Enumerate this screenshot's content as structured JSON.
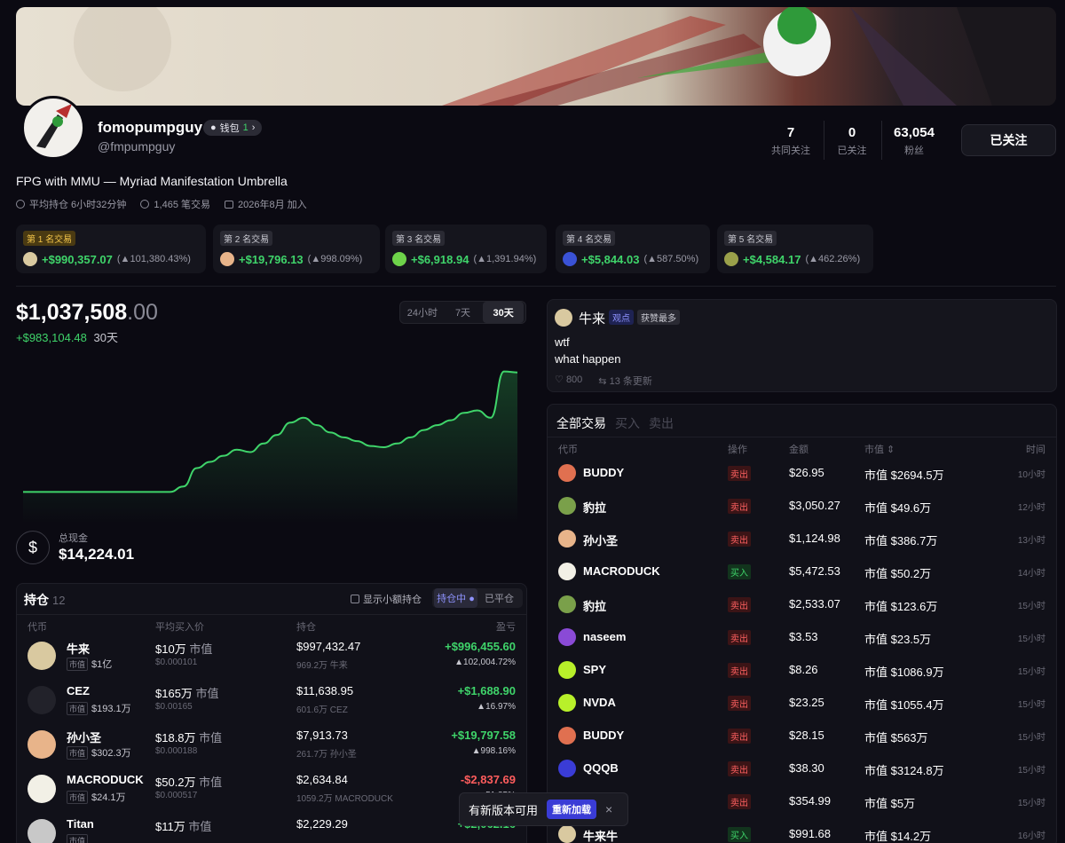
{
  "profile": {
    "name": "fomopumpguy",
    "handle": "@fmpumpguy",
    "wallet_label": "钱包",
    "wallet_count": "1",
    "bio": "FPG with MMU — Myriad Manifestation Umbrella",
    "avg_hold": "平均持仓 6小时32分钟",
    "trades": "1,465 笔交易",
    "joined": "2026年8月 加入"
  },
  "stats": [
    {
      "n": "7",
      "l": "共同关注"
    },
    {
      "n": "0",
      "l": "已关注"
    },
    {
      "n": "63,054",
      "l": "粉丝"
    }
  ],
  "follow_label": "已关注",
  "top_trades": [
    {
      "badge": "第 1 名交易",
      "amount": "+$990,357.07",
      "pct": "101,380.43%",
      "color": "#d9c9a0",
      "gold": true
    },
    {
      "badge": "第 2 名交易",
      "amount": "+$19,796.13",
      "pct": "998.09%",
      "color": "#e8b48a"
    },
    {
      "badge": "第 3 名交易",
      "amount": "+$6,918.94",
      "pct": "1,391.94%",
      "color": "#6ed34a"
    },
    {
      "badge": "第 4 名交易",
      "amount": "+$5,844.03",
      "pct": "587.50%",
      "color": "#3a52d6"
    },
    {
      "badge": "第 5 名交易",
      "amount": "+$4,584.17",
      "pct": "462.26%",
      "color": "#9aa04a"
    }
  ],
  "balance": {
    "main": "$1,037,508",
    "dec": ".00",
    "change": "+$983,104.48",
    "period": "30天"
  },
  "ranges": [
    "24小时",
    "7天",
    "30天"
  ],
  "cash": {
    "label": "总现金",
    "value": "$14,224.01",
    "icon": "$"
  },
  "holdings": {
    "title": "持仓",
    "count": "12",
    "show_small": "显示小额持仓",
    "seg_open": "持仓中",
    "seg_closed": "已平仓",
    "headers": [
      "代币",
      "平均买入价",
      "持仓",
      "盈亏"
    ],
    "rows": [
      {
        "name": "牛来",
        "tag": "市值",
        "mc": "$1亿",
        "avg": "$10万",
        "avg_unit": "市值",
        "avg_sub": "$0.000101",
        "hold": "$997,432.47",
        "hold_sub": "969.2万 牛来",
        "pnl": "+$996,455.60",
        "pnl_pct": "▲102,004.72%",
        "up": true,
        "color": "#d9c9a0"
      },
      {
        "name": "CEZ",
        "tag": "市值",
        "mc": "$193.1万",
        "avg": "$165万",
        "avg_unit": "市值",
        "avg_sub": "$0.00165",
        "hold": "$11,638.95",
        "hold_sub": "601.6万 CEZ",
        "pnl": "+$1,688.90",
        "pnl_pct": "▲16.97%",
        "up": true,
        "color": "#22222a"
      },
      {
        "name": "孙小圣",
        "tag": "市值",
        "mc": "$302.3万",
        "avg": "$18.8万",
        "avg_unit": "市值",
        "avg_sub": "$0.000188",
        "hold": "$7,913.73",
        "hold_sub": "261.7万 孙小圣",
        "pnl": "+$19,797.58",
        "pnl_pct": "▲998.16%",
        "up": true,
        "color": "#e8b48a"
      },
      {
        "name": "MACRODUCK",
        "tag": "市值",
        "mc": "$24.1万",
        "avg": "$50.2万",
        "avg_unit": "市值",
        "avg_sub": "$0.000517",
        "hold": "$2,634.84",
        "hold_sub": "1059.2万 MACRODUCK",
        "pnl": "-$2,837.69",
        "pnl_pct": "▼51.85%",
        "up": false,
        "color": "#f2f0e6"
      },
      {
        "name": "Titan",
        "tag": "市值",
        "mc": "",
        "avg": "$11万",
        "avg_unit": "市值",
        "avg_sub": "",
        "hold": "$2,229.29",
        "hold_sub": "",
        "pnl": "+$2,062.16",
        "pnl_pct": "",
        "up": true,
        "color": "#c8c8c8"
      }
    ]
  },
  "post": {
    "author": "牛来",
    "badge1": "观点",
    "badge2": "获赞最多",
    "line1": "wtf",
    "line2": "what happen",
    "likes": "800",
    "updates": "13 条更新"
  },
  "trades": {
    "tabs": [
      "全部交易",
      "买入",
      "卖出"
    ],
    "headers": [
      "代币",
      "操作",
      "金额",
      "市值 ⇕",
      "时间"
    ],
    "rows": [
      {
        "token": "BUDDY",
        "side": "卖出",
        "buy": false,
        "amount": "$26.95",
        "mc": "市值 $2694.5万",
        "time": "10小时",
        "color": "#e07050"
      },
      {
        "token": "豹拉",
        "side": "卖出",
        "buy": false,
        "amount": "$3,050.27",
        "mc": "市值 $49.6万",
        "time": "12小时",
        "color": "#7aa04a"
      },
      {
        "token": "孙小圣",
        "side": "卖出",
        "buy": false,
        "amount": "$1,124.98",
        "mc": "市值 $386.7万",
        "time": "13小时",
        "color": "#e8b48a"
      },
      {
        "token": "MACRODUCK",
        "side": "买入",
        "buy": true,
        "amount": "$5,472.53",
        "mc": "市值 $50.2万",
        "time": "14小时",
        "color": "#f2f0e6"
      },
      {
        "token": "豹拉",
        "side": "卖出",
        "buy": false,
        "amount": "$2,533.07",
        "mc": "市值 $123.6万",
        "time": "15小时",
        "color": "#7aa04a"
      },
      {
        "token": "naseem",
        "side": "卖出",
        "buy": false,
        "amount": "$3.53",
        "mc": "市值 $23.5万",
        "time": "15小时",
        "color": "#8a4ad6"
      },
      {
        "token": "SPY",
        "side": "卖出",
        "buy": false,
        "amount": "$8.26",
        "mc": "市值 $1086.9万",
        "time": "15小时",
        "color": "#b8f02a"
      },
      {
        "token": "NVDA",
        "side": "卖出",
        "buy": false,
        "amount": "$23.25",
        "mc": "市值 $1055.4万",
        "time": "15小时",
        "color": "#b8f02a"
      },
      {
        "token": "BUDDY",
        "side": "卖出",
        "buy": false,
        "amount": "$28.15",
        "mc": "市值 $563万",
        "time": "15小时",
        "color": "#e07050"
      },
      {
        "token": "QQQB",
        "side": "卖出",
        "buy": false,
        "amount": "$38.30",
        "mc": "市值 $3124.8万",
        "time": "15小时",
        "color": "#3a3cd6"
      },
      {
        "token": "",
        "side": "卖出",
        "buy": false,
        "amount": "$354.99",
        "mc": "市值 $5万",
        "time": "15小时",
        "color": "#5a5a66"
      },
      {
        "token": "牛来牛",
        "side": "买入",
        "buy": true,
        "amount": "$991.68",
        "mc": "市值 $14.2万",
        "time": "16小时",
        "color": "#d9c9a0"
      }
    ]
  },
  "toast": {
    "text": "有新版本可用",
    "button": "重新加载",
    "close": "×"
  },
  "chart_data": {
    "type": "area",
    "title": "",
    "series": [
      {
        "values": [
          54.8,
          54.8,
          54.8,
          54.8,
          54.8,
          54.8,
          54.8,
          54.8,
          54.8,
          54.8,
          54.8,
          54.8,
          100,
          250,
          300,
          350,
          400,
          380,
          450,
          520,
          620,
          660,
          600,
          540,
          500,
          470,
          430,
          420,
          450,
          500,
          560,
          600,
          640,
          700,
          720,
          660,
          1037.5,
          1030
        ]
      }
    ],
    "ylim": [
      0,
      1100
    ],
    "units": "$K",
    "grid": false
  }
}
